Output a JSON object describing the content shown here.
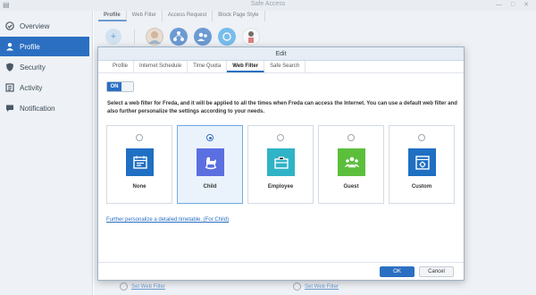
{
  "window": {
    "title": "Safe Access",
    "controls": "— □ ✕"
  },
  "sidebar": {
    "items": [
      {
        "label": "Overview",
        "icon": "overview-icon"
      },
      {
        "label": "Profile",
        "icon": "profile-icon"
      },
      {
        "label": "Security",
        "icon": "shield-icon"
      },
      {
        "label": "Activity",
        "icon": "activity-icon"
      },
      {
        "label": "Notification",
        "icon": "notification-icon"
      }
    ],
    "active": "Profile"
  },
  "main": {
    "tabs": [
      "Profile",
      "Web Filter",
      "Access Request",
      "Block Page Style"
    ],
    "active_tab": "Profile",
    "add_label": "+",
    "profile_avatars": [
      "freda-avatar",
      "network-avatar",
      "group-avatar",
      "circle-avatar",
      "person-avatar"
    ],
    "bottom_links": [
      "Set Web Filter",
      "Set Web Filter"
    ]
  },
  "dialog": {
    "title": "Edit",
    "tabs": [
      "Profile",
      "Internet Schedule",
      "Time Quota",
      "Web Filter",
      "Safe Search"
    ],
    "active_tab": "Web Filter",
    "toggle_label": "ON",
    "description": "Select a web filter for Freda, and it will be applied to all the times when Freda can access the Internet. You can use a default web filter and also further personalize the settings according to your needs.",
    "filters": [
      {
        "label": "None",
        "color": "#1f6fc2",
        "icon": "calendar-icon",
        "selected": false
      },
      {
        "label": "Child",
        "color": "#5b6fe0",
        "icon": "rocking-horse-icon",
        "selected": true
      },
      {
        "label": "Employee",
        "color": "#2fb3c6",
        "icon": "briefcase-icon",
        "selected": false
      },
      {
        "label": "Guest",
        "color": "#5cbf3c",
        "icon": "guests-icon",
        "selected": false
      },
      {
        "label": "Custom",
        "color": "#1f6fc2",
        "icon": "custom-settings-icon",
        "selected": false
      }
    ],
    "personalize_link": "Further personalize a detailed timetable. (For Child)",
    "ok_label": "OK",
    "cancel_label": "Cancel"
  }
}
